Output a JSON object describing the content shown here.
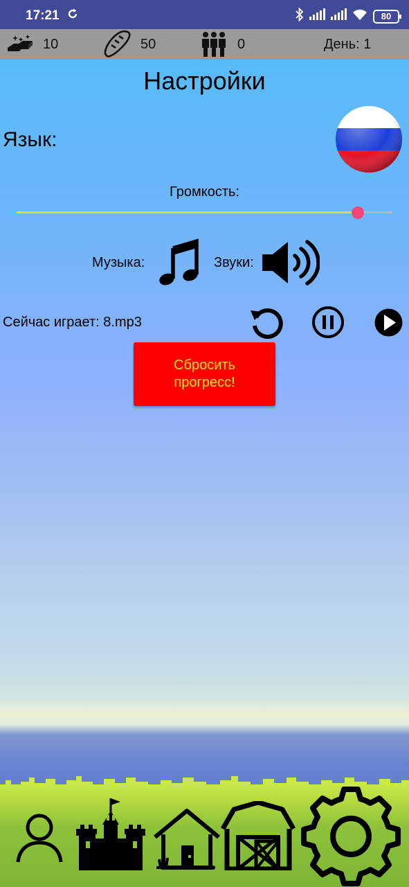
{
  "status_bar": {
    "time": "17:21",
    "battery": "80"
  },
  "resources": {
    "gold": "10",
    "bread": "50",
    "people": "0",
    "day": "День: 1"
  },
  "settings": {
    "title": "Настройки",
    "language_label": "Язык:",
    "language_flag": "russia-flag",
    "volume_label": "Громкость:",
    "volume_level": 0.91,
    "music_label": "Музыка:",
    "sounds_label": "Звуки:",
    "now_playing": "Сейчас играет: 8.mp3",
    "reset_button": "Сбросить прогресс!"
  },
  "colors": {
    "status_bar": "#404a97",
    "resource_bar": "#9a9a9a",
    "reset_button_bg": "#ff0000",
    "reset_button_text": "#f8e31a",
    "slider_fill": "#f3d23a",
    "slider_thumb": "#f5457a"
  },
  "bottom_nav": [
    "profile-icon",
    "castle-icon",
    "house-icon",
    "barn-icon",
    "settings-gear-icon"
  ]
}
